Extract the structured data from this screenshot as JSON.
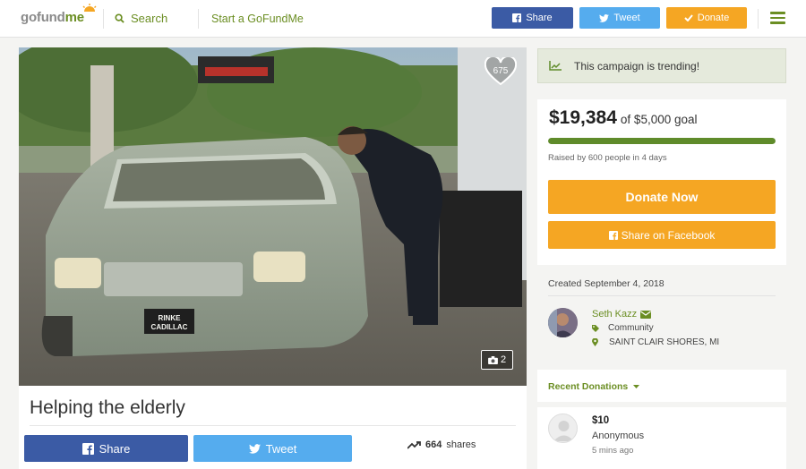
{
  "header": {
    "logo_go": "gofund",
    "logo_me": "me",
    "search_label": "Search",
    "start_label": "Start a GoFundMe",
    "share_label": "Share",
    "tweet_label": "Tweet",
    "donate_label": "Donate"
  },
  "photo": {
    "heart_count": "675",
    "photo_count": "2",
    "plate_line1": "RINKE",
    "plate_line2": "CADILLAC"
  },
  "campaign": {
    "title": "Helping the elderly",
    "share_label": "Share",
    "tweet_label": "Tweet",
    "shares_count": "664",
    "shares_suffix": "shares"
  },
  "sidebar": {
    "trending_text": "This campaign is trending!",
    "raised_amount": "$19,384",
    "goal_text": "of $5,000 goal",
    "progress_fraction": 1.0,
    "raised_by": "Raised by 600 people in 4 days",
    "donate_now_label": "Donate Now",
    "share_facebook_label": "Share on Facebook",
    "created_text": "Created September 4, 2018",
    "organizer_name": "Seth Kazz",
    "organizer_category": "Community",
    "organizer_location": "SAINT CLAIR SHORES, MI",
    "recent_donations_label": "Recent Donations",
    "donations": [
      {
        "amount": "$10",
        "name": "Anonymous",
        "time": "5 mins ago"
      }
    ]
  },
  "colors": {
    "brand_green": "#6b8e23",
    "facebook_blue": "#3b5ba5",
    "twitter_blue": "#55acee",
    "donate_orange": "#f5a623",
    "progress_green": "#5f8b2a"
  }
}
